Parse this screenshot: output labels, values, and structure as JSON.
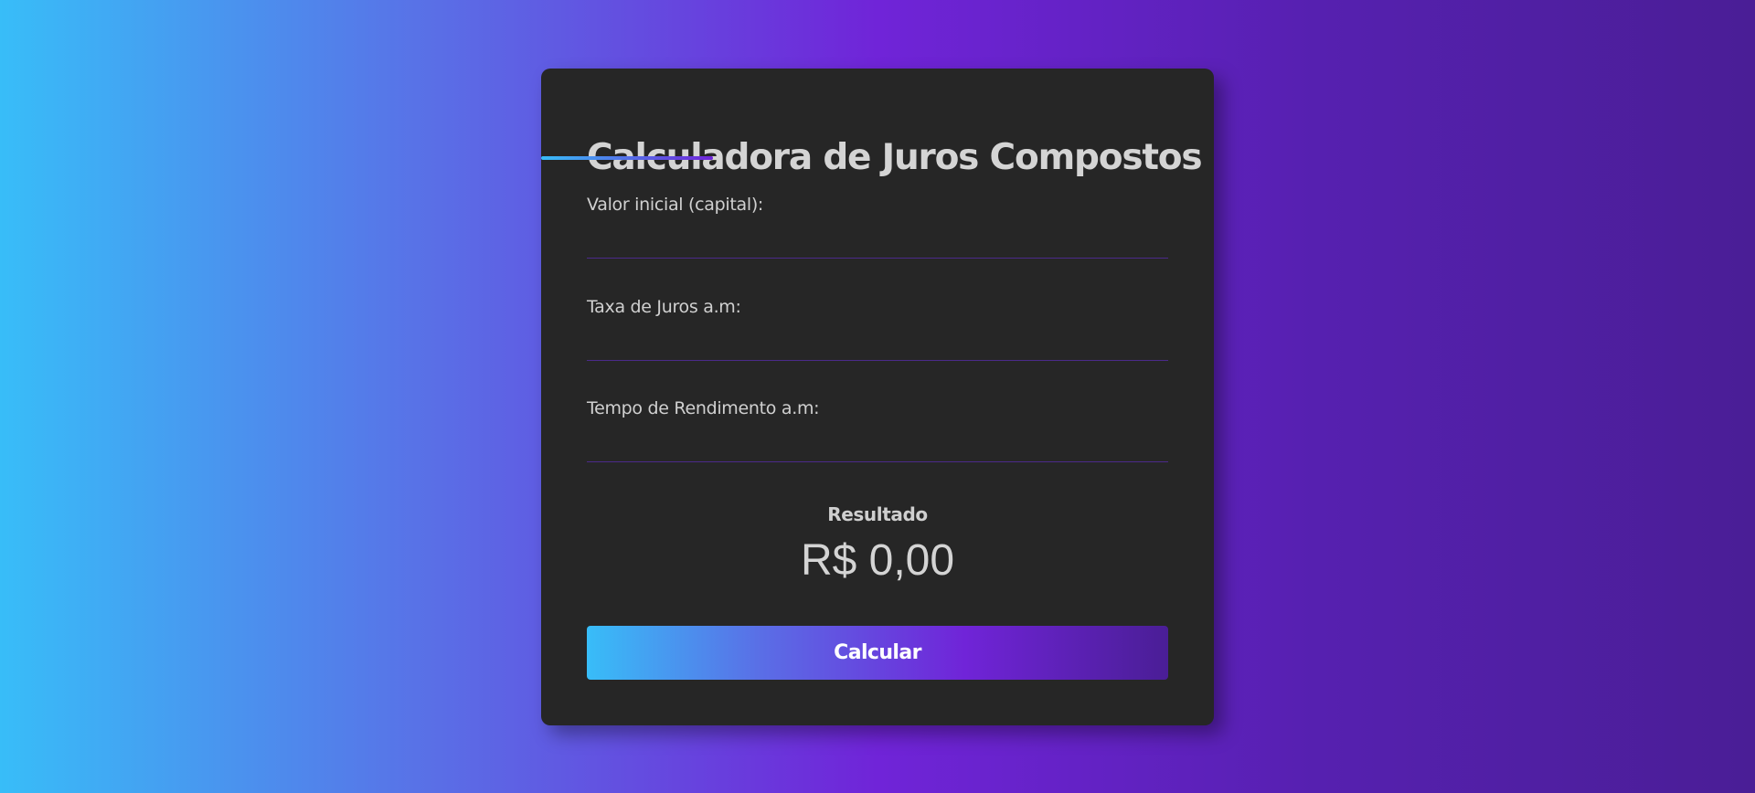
{
  "calculator": {
    "title": "Calculadora de Juros Compostos",
    "fields": [
      {
        "label": "Valor inicial (capital):",
        "value": "",
        "placeholder": ""
      },
      {
        "label": "Taxa de Juros a.m:",
        "value": "",
        "placeholder": ""
      },
      {
        "label": "Tempo de Rendimento a.m:",
        "value": "",
        "placeholder": ""
      }
    ],
    "result_label": "Resultado",
    "result_value": "R$ 0,00",
    "button_label": "Calcular"
  },
  "colors": {
    "background_start": "#38bdf8",
    "background_mid": "#7024d8",
    "background_end": "#4a1e96",
    "card": "#262626",
    "text": "#d4d4d4",
    "input_border": "#4b2a8a"
  }
}
